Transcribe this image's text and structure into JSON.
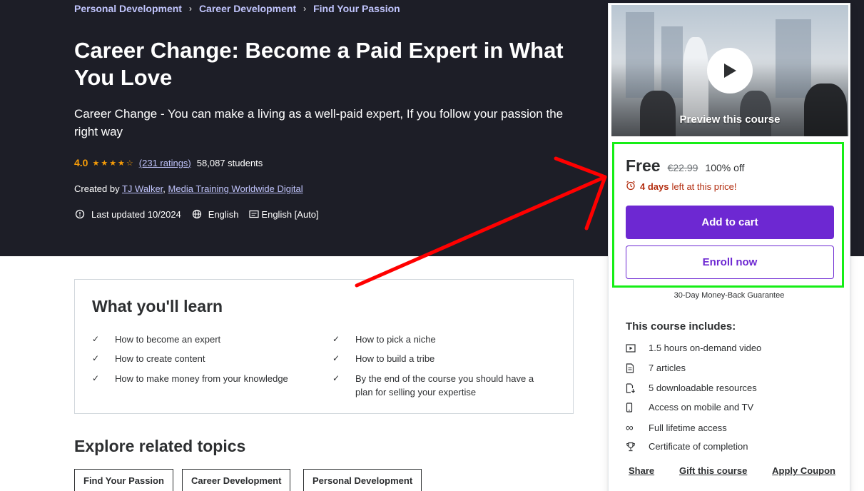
{
  "breadcrumb": [
    "Personal Development",
    "Career Development",
    "Find Your Passion"
  ],
  "course": {
    "title": "Career Change: Become a Paid Expert in What You Love",
    "subtitle": "Career Change - You can make a living as a well-paid expert, If you follow your passion the right way",
    "rating": "4.0",
    "stars": "★★★★☆",
    "ratings_count": "(231 ratings)",
    "students": "58,087 students",
    "created_by_label": "Created by",
    "authors": [
      "TJ Walker",
      "Media Training Worldwide Digital"
    ],
    "author_separator": ",",
    "last_updated": "Last updated 10/2024",
    "language": "English",
    "captions": "English [Auto]"
  },
  "learn": {
    "title": "What you'll learn",
    "items": [
      "How to become an expert",
      "How to pick a niche",
      "How to create content",
      "How to build a tribe",
      "How to make money from your knowledge",
      "By the end of the course you should have a plan for selling your expertise"
    ]
  },
  "explore": {
    "title": "Explore related topics",
    "tags": [
      "Find Your Passion",
      "Career Development",
      "Personal Development"
    ]
  },
  "card": {
    "preview_label": "Preview this course",
    "price": "Free",
    "original_price": "€22.99",
    "discount": "100% off",
    "timer_bold": "4 days",
    "timer_rest": "left at this price!",
    "add_to_cart": "Add to cart",
    "enroll_now": "Enroll now",
    "guarantee": "30-Day Money-Back Guarantee",
    "includes_title": "This course includes:",
    "includes": [
      {
        "icon": "video-icon",
        "text": "1.5 hours on-demand video"
      },
      {
        "icon": "article-icon",
        "text": "7 articles"
      },
      {
        "icon": "download-icon",
        "text": "5 downloadable resources"
      },
      {
        "icon": "mobile-icon",
        "text": "Access on mobile and TV"
      },
      {
        "icon": "infinity-icon",
        "text": "Full lifetime access"
      },
      {
        "icon": "trophy-icon",
        "text": "Certificate of completion"
      }
    ],
    "links": [
      "Share",
      "Gift this course",
      "Apply Coupon"
    ]
  },
  "colors": {
    "hero_bg": "#1d1e27",
    "accent_purple": "#6d28d2",
    "link_lavender": "#c0c4fc",
    "star_orange": "#f69c08",
    "timer_red": "#b32d0f",
    "annotation_green": "#16ee16",
    "annotation_red": "#ff0000"
  }
}
